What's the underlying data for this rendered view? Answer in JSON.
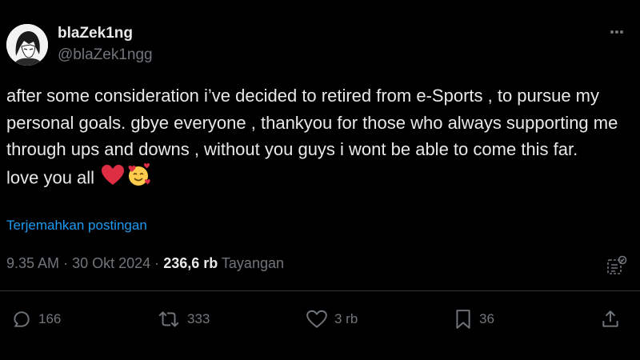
{
  "author": {
    "name": "blaZek1ng",
    "handle": "@blaZek1ngg",
    "avatar_icon": "anime-avatar-icon"
  },
  "tweet": {
    "paragraph1": "after some consideration i’ve decided to retired from e-Sports , to pursue my personal goals. gbye everyone , thankyou for those who always supporting me through ups and downs , without you guys i wont be able to come this far.",
    "paragraph2": "love you all"
  },
  "translate_link": "Terjemahkan postingan",
  "meta": {
    "time": "9.35 AM",
    "sep1": "·",
    "date": "30 Okt 2024",
    "sep2": "·",
    "views_count": "236,6 rb",
    "views_label": "Tayangan"
  },
  "actions": {
    "replies": "166",
    "reposts": "333",
    "likes": "3 rb",
    "bookmarks": "36"
  },
  "colors": {
    "background": "#000000",
    "text": "#e7e9ea",
    "muted": "#71767b",
    "link": "#1d9bf0"
  }
}
